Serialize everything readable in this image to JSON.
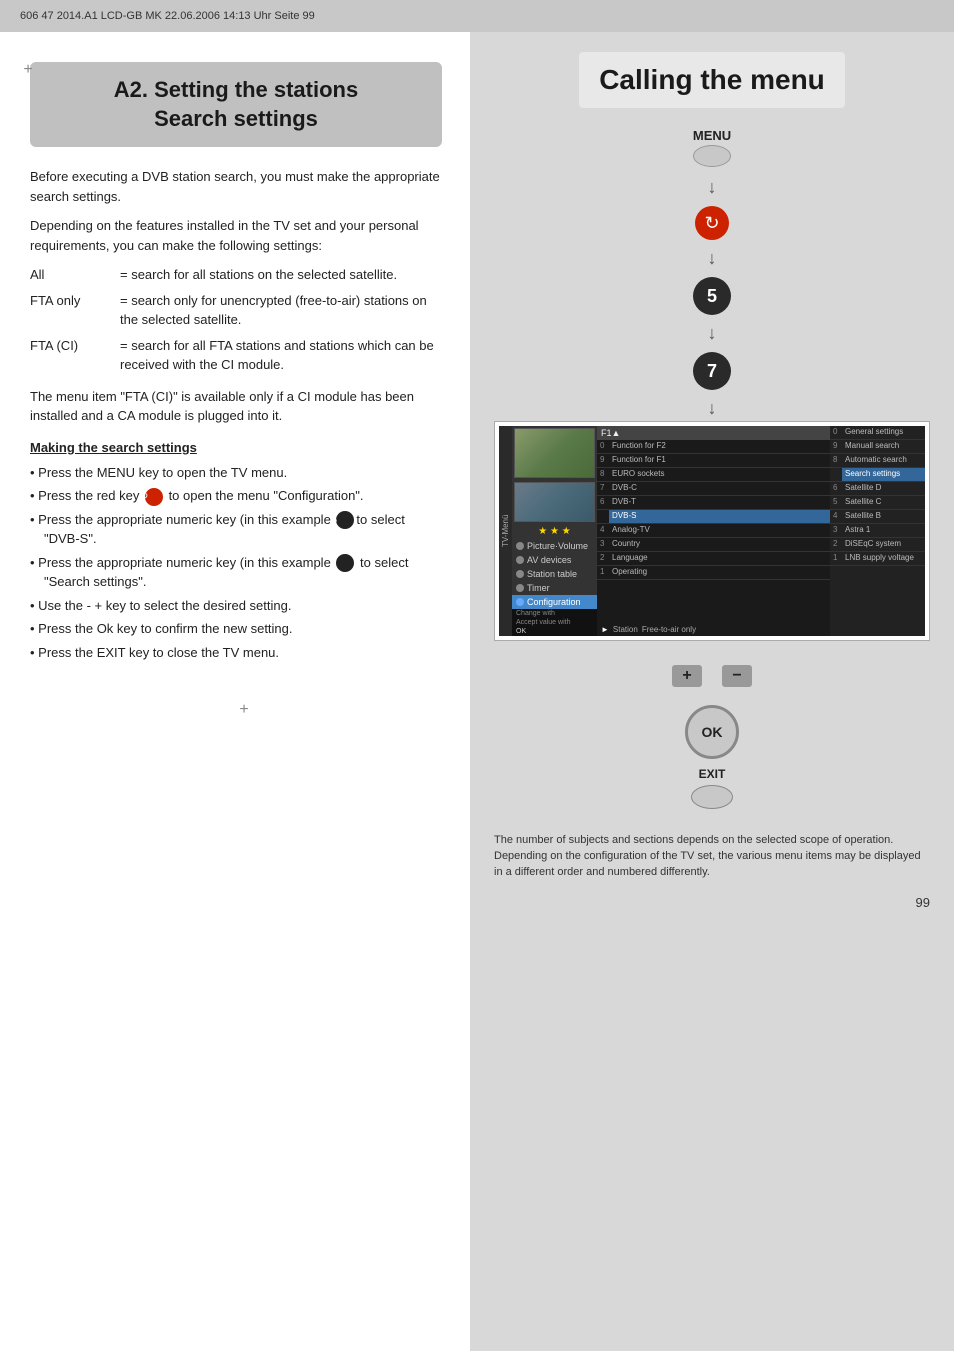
{
  "header": {
    "text": "606 47 2014.A1 LCD-GB  MK  22.06.2006  14:13 Uhr  Seite 99"
  },
  "left": {
    "title_line1": "A2. Setting the stations",
    "title_line2": "Search settings",
    "para1": "Before executing a DVB station search, you must make the appropriate search settings.",
    "para2": "Depending on the features installed in the TV set and your personal requirements, you can make the following settings:",
    "def_items": [
      {
        "term": "All",
        "desc": "= search for all stations on the selected satellite."
      },
      {
        "term": "FTA only",
        "desc": "= search only for unencrypted (free-to-air) stations on the selected satellite."
      },
      {
        "term": "FTA (CI)",
        "desc": "= search for all FTA stations and stations which can be received with the CI module."
      }
    ],
    "ci_note": "The menu item \"FTA (CI)\" is available only if a CI module has been installed and a CA module is plugged into it.",
    "making_heading": "Making the search settings",
    "bullets": [
      "Press the MENU key to open the TV menu.",
      "Press the red key  to open the menu \"Configuration\".",
      "Press the appropriate numeric key (in this example  to select \"DVB-S\".",
      "Press the appropriate numeric key (in this example  to select \"Search settings\".",
      "Use the - + key to select the desired setting.",
      "Press the Ok key to confirm the new setting.",
      "Press the EXIT key to close the TV menu."
    ]
  },
  "right": {
    "title": "Calling the menu",
    "menu_label": "MENU",
    "step5_label": "5",
    "step7_label": "7",
    "ok_label": "OK",
    "exit_label": "EXIT",
    "tv_menu": {
      "top_bar": "F1",
      "left_rows": [
        {
          "num": "0",
          "label": "Function for F2"
        },
        {
          "num": "9",
          "label": "Function for F1"
        },
        {
          "num": "8",
          "label": "EURO sockets"
        },
        {
          "num": "7",
          "label": "DVB-C"
        },
        {
          "num": "6",
          "label": "DVB-T"
        },
        {
          "num": "",
          "label": "DVB-S",
          "highlighted": true
        },
        {
          "num": "4",
          "label": "Analog-TV"
        },
        {
          "num": "3",
          "label": "Country"
        },
        {
          "num": "2",
          "label": "Language"
        },
        {
          "num": "1",
          "label": "Operating"
        }
      ],
      "right_rows": [
        {
          "num": "0",
          "label": "General settings"
        },
        {
          "num": "9",
          "label": "Manuall search"
        },
        {
          "num": "8",
          "label": "Automatic search"
        },
        {
          "num": "",
          "label": "Search settings",
          "highlighted": true
        },
        {
          "num": "6",
          "label": "Satellite D"
        },
        {
          "num": "5",
          "label": "Satellite C"
        },
        {
          "num": "4",
          "label": "Satellite B"
        },
        {
          "num": "3",
          "label": "Astra 1"
        },
        {
          "num": "2",
          "label": "DiSEqC system"
        },
        {
          "num": "1",
          "label": "LNB supply voltage"
        }
      ],
      "sidebar_items": [
        {
          "label": "Picture·Volume",
          "active": false
        },
        {
          "label": "AV devices",
          "active": false
        },
        {
          "label": "Station table",
          "active": false
        },
        {
          "label": "Timer",
          "active": false
        },
        {
          "label": "Configuration",
          "active": true
        }
      ],
      "change_row": "Change with",
      "accept_row": "Accept value with",
      "ok_small": "OK",
      "footer_text": "Stations   Free-to-air only",
      "station_label": "Station"
    },
    "footnote": "The number of subjects and sections depends on the selected scope of operation. Depending on the configuration of the TV set, the various menu items may be displayed in a different order and numbered differently.",
    "page_number": "99"
  }
}
